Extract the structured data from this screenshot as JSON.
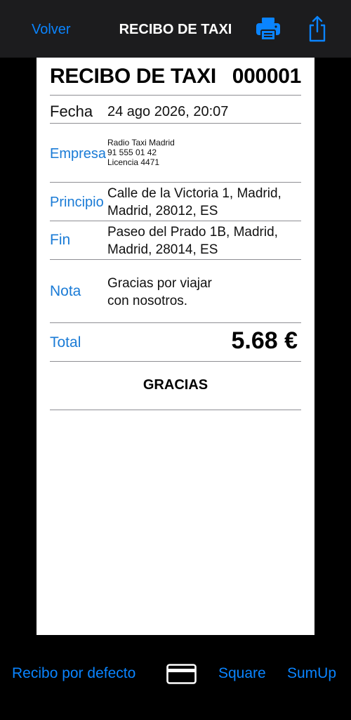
{
  "nav": {
    "back_label": "Volver",
    "title": "RECIBO DE TAXI",
    "print_icon": "printer-icon",
    "share_icon": "share-icon"
  },
  "receipt": {
    "title": "RECIBO DE TAXI",
    "number": "000001",
    "fecha_label": "Fecha",
    "fecha_value": "24 ago 2026, 20:07",
    "empresa_label": "Empresa",
    "empresa_lines": [
      "Radio Taxi Madrid",
      "91 555 01 42",
      "Licencia 4471"
    ],
    "principio_label": "Principio",
    "principio_lines": [
      "Calle de la Victoria 1, Madrid,",
      "Madrid, 28012, ES"
    ],
    "fin_label": "Fin",
    "fin_lines": [
      "Paseo del Prado 1B, Madrid,",
      "Madrid, 28014, ES"
    ],
    "nota_label": "Nota",
    "nota_lines": [
      "Gracias por viajar",
      "con nosotros."
    ],
    "total_label": "Total",
    "total_value": "5.68 €",
    "footer": "GRACIAS"
  },
  "bottom_bar": {
    "default_receipt": "Recibo por defecto",
    "card_icon": "credit-card-icon",
    "square": "Square",
    "sumup": "SumUp"
  },
  "colors": {
    "accent": "#0a84ff",
    "label_blue": "#1a7bd6",
    "background": "#000000",
    "navbar": "#1c1c1e",
    "paper": "#ffffff"
  }
}
